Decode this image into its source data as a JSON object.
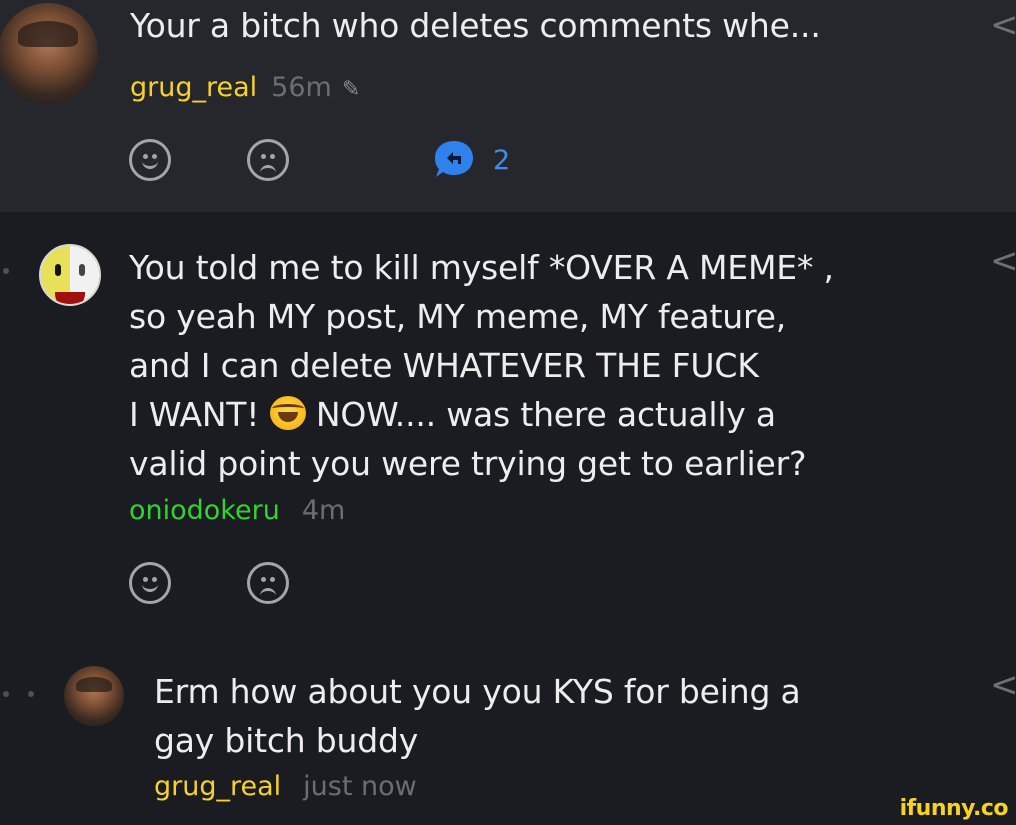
{
  "comments": [
    {
      "text": "Your a bitch who deletes comments whe...",
      "username": "grug_real",
      "time": "56m",
      "edit_icon": "pencil-icon",
      "reply_count": "2",
      "username_color": "#f5d22d"
    },
    {
      "text": "You told me to kill myself *OVER A MEME* ,\nso yeah MY post, MY meme, MY feature,\nand I can delete WHATEVER THE FUCK\nI WANT!",
      "text_after_emoji": " NOW.... was there actually a\nvalid point you were trying get to earlier?",
      "emoji": "joy-emoji",
      "username": "oniodokeru",
      "time": "4m",
      "username_color": "#34d134"
    },
    {
      "text": "Erm how about you you KYS for being a\ngay bitch buddy",
      "username": "grug_real",
      "time": "just now",
      "username_color": "#f5d22d"
    }
  ],
  "watermark": "ifunny.co",
  "colors": {
    "background": "#1b1c21",
    "top_panel": "#26272c",
    "reply_accent": "#3d8ef2"
  }
}
